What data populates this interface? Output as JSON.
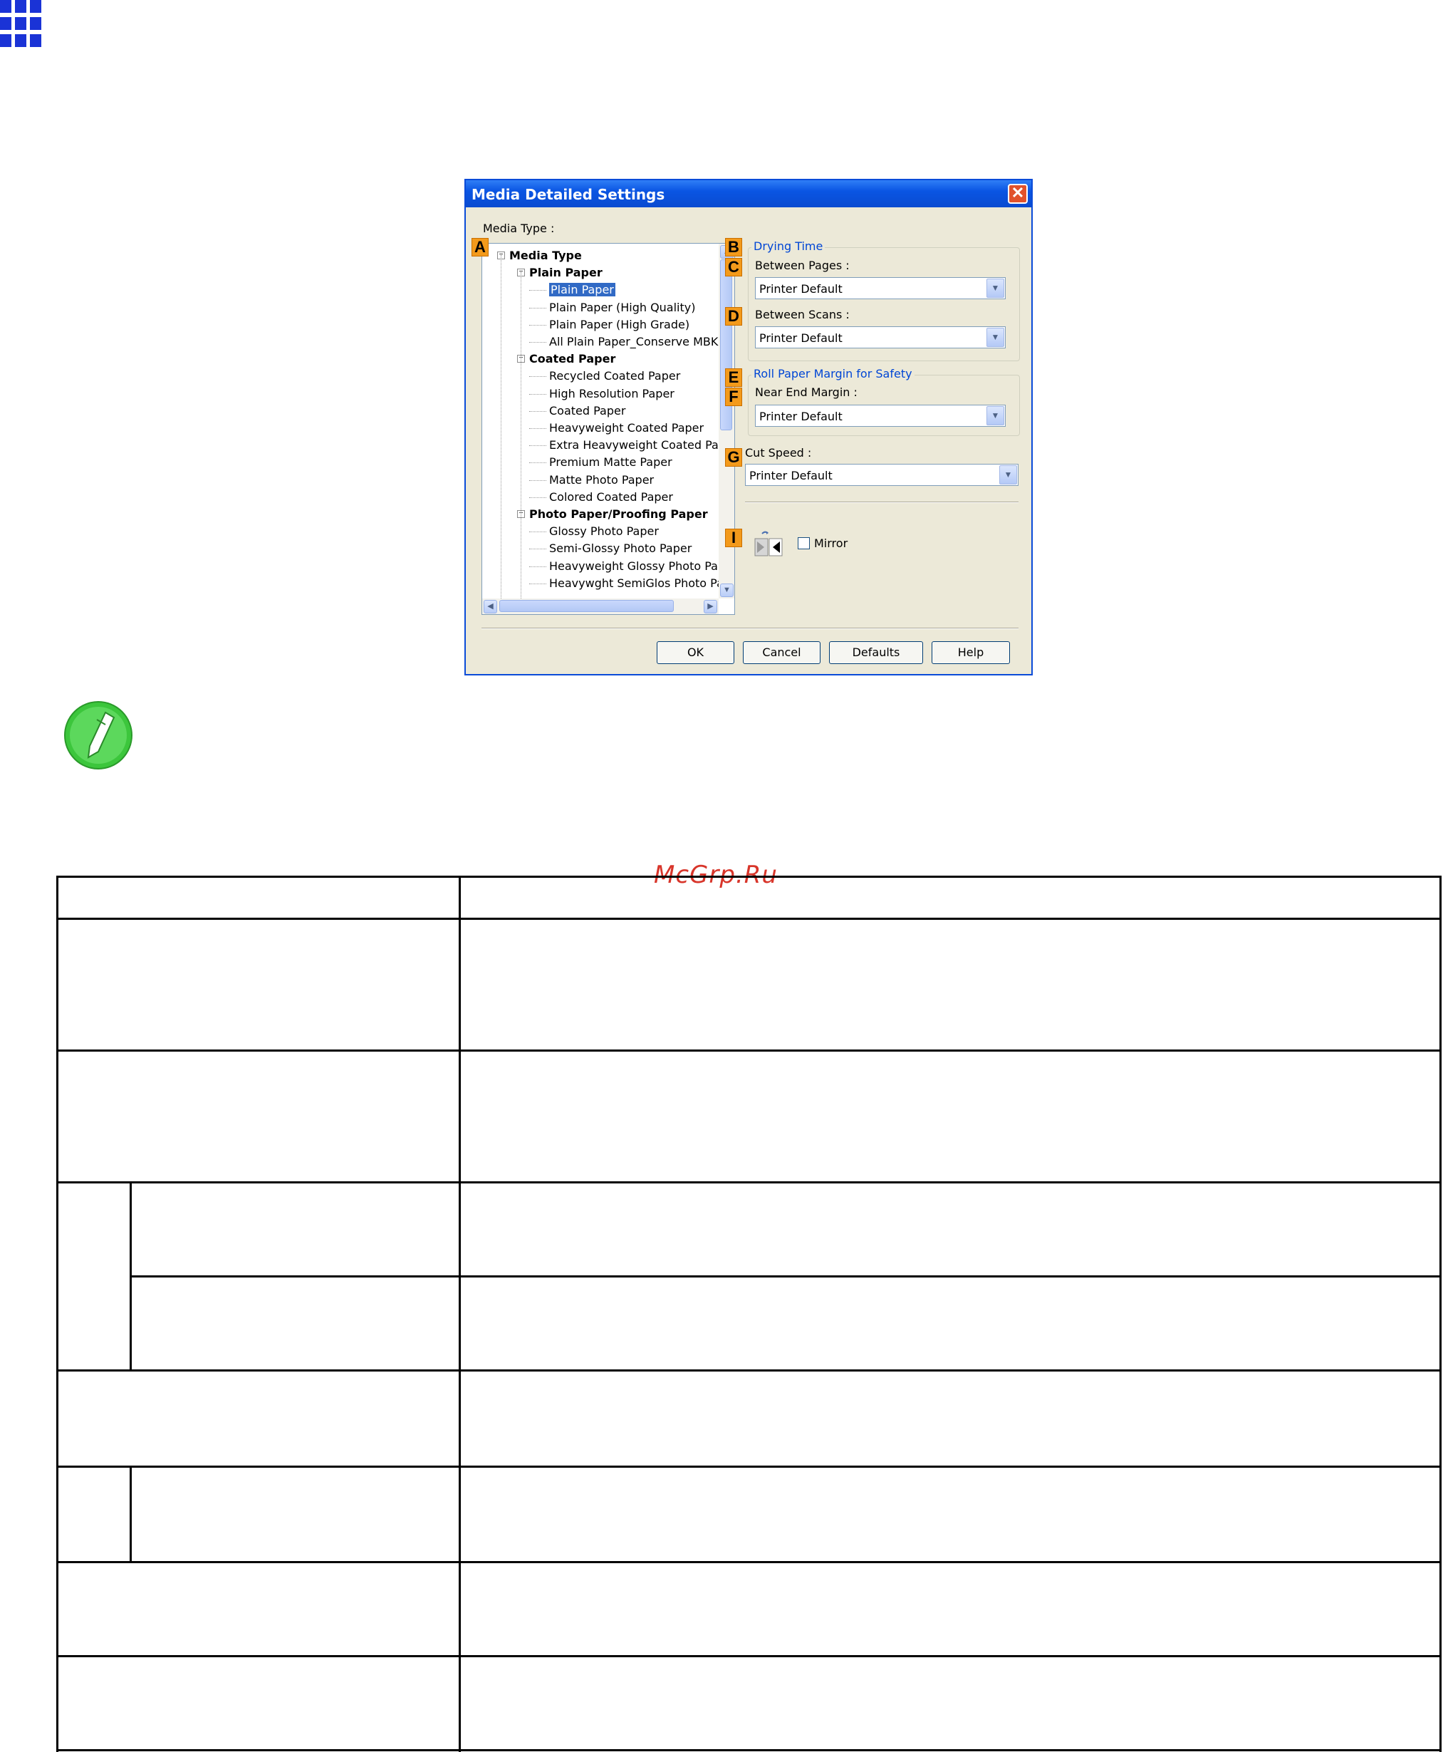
{
  "dialog": {
    "title": "Media Detailed Settings",
    "close_label": "✕",
    "media_type_label": "Media Type :",
    "tree": [
      {
        "label": "Media Type",
        "level": 0,
        "bold": true,
        "selected": false,
        "expander": true
      },
      {
        "label": "Plain Paper",
        "level": 1,
        "bold": true,
        "selected": false,
        "expander": true
      },
      {
        "label": "Plain Paper",
        "level": 2,
        "bold": false,
        "selected": true,
        "expander": false
      },
      {
        "label": "Plain Paper (High Quality)",
        "level": 2,
        "bold": false,
        "selected": false,
        "expander": false
      },
      {
        "label": "Plain Paper (High Grade)",
        "level": 2,
        "bold": false,
        "selected": false,
        "expander": false
      },
      {
        "label": "All Plain Paper_Conserve MBK",
        "level": 2,
        "bold": false,
        "selected": false,
        "expander": false
      },
      {
        "label": "Coated Paper",
        "level": 1,
        "bold": true,
        "selected": false,
        "expander": true
      },
      {
        "label": "Recycled Coated Paper",
        "level": 2,
        "bold": false,
        "selected": false,
        "expander": false
      },
      {
        "label": "High Resolution Paper",
        "level": 2,
        "bold": false,
        "selected": false,
        "expander": false
      },
      {
        "label": "Coated Paper",
        "level": 2,
        "bold": false,
        "selected": false,
        "expander": false
      },
      {
        "label": "Heavyweight Coated Paper",
        "level": 2,
        "bold": false,
        "selected": false,
        "expander": false
      },
      {
        "label": "Extra Heavyweight Coated Pape",
        "level": 2,
        "bold": false,
        "selected": false,
        "expander": false
      },
      {
        "label": "Premium Matte Paper",
        "level": 2,
        "bold": false,
        "selected": false,
        "expander": false
      },
      {
        "label": "Matte Photo Paper",
        "level": 2,
        "bold": false,
        "selected": false,
        "expander": false
      },
      {
        "label": "Colored Coated Paper",
        "level": 2,
        "bold": false,
        "selected": false,
        "expander": false
      },
      {
        "label": "Photo Paper/Proofing Paper",
        "level": 1,
        "bold": true,
        "selected": false,
        "expander": true
      },
      {
        "label": "Glossy Photo Paper",
        "level": 2,
        "bold": false,
        "selected": false,
        "expander": false
      },
      {
        "label": "Semi-Glossy Photo Paper",
        "level": 2,
        "bold": false,
        "selected": false,
        "expander": false
      },
      {
        "label": "Heavyweight Glossy Photo Pape",
        "level": 2,
        "bold": false,
        "selected": false,
        "expander": false
      },
      {
        "label": "Heavywght SemiGlos Photo Pap",
        "level": 2,
        "bold": false,
        "selected": false,
        "expander": false
      }
    ],
    "badges": {
      "a": "A",
      "b": "B",
      "c": "C",
      "d": "D",
      "e": "E",
      "f": "F",
      "g": "G",
      "i": "I"
    },
    "drying_time_title": "Drying Time",
    "between_pages_label": "Between Pages :",
    "between_pages_value": "Printer Default",
    "between_scans_label": "Between Scans :",
    "between_scans_value": "Printer Default",
    "roll_margin_title": "Roll Paper Margin for Safety",
    "near_end_margin_label": "Near End Margin :",
    "near_end_margin_value": "Printer Default",
    "cut_speed_label": "Cut Speed :",
    "cut_speed_value": "Printer Default",
    "mirror_label": "Mirror",
    "mirror_checked": false,
    "buttons": {
      "ok": "OK",
      "cancel": "Cancel",
      "defaults": "Defaults",
      "help": "Help"
    }
  },
  "watermark": "McGrp.Ru",
  "colors": {
    "badge": "#f39a1b",
    "titlebar": "#0a55e3",
    "note_icon": "#3cc63c",
    "grid_icon": "#1a33d6"
  },
  "icons": {
    "top_left": "grid-icon",
    "note": "note-pencil-icon",
    "mirror": "mirror-icon"
  }
}
